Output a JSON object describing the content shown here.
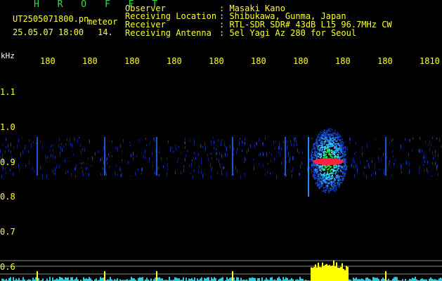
{
  "header": {
    "app_title": "H R O F F T",
    "filename": "UT2505071800.pn",
    "tag": "meteor",
    "datetime": "25.05.07 18:00",
    "minute": "14.",
    "info": [
      {
        "label": "Observer",
        "value": ": Masaki Kano"
      },
      {
        "label": "Receiving Location",
        "value": ": Shibukawa, Gunma, Japan"
      },
      {
        "label": "Receiver",
        "value": ": RTL-SDR SDR# 43dB L15 96.7MHz CW"
      },
      {
        "label": "Receiving Antenna",
        "value": ": 5el Yagi Az 280 for Seoul"
      }
    ]
  },
  "axis": {
    "unit": "kHz",
    "top_ticks": [
      "180",
      "180",
      "180",
      "180",
      "180",
      "180",
      "180",
      "180",
      "180",
      "1810"
    ],
    "y_ticks": [
      "1.1",
      "1.0",
      "0.9",
      "0.8",
      "0.7",
      "0.6"
    ]
  },
  "colors": {
    "label_yellow": "#ffff33",
    "title_green": "#33dd44",
    "echo_red": "#ff2244",
    "echo_cyan": "#33ddff",
    "echo_green": "#22dd44",
    "bg": "#000000"
  }
}
